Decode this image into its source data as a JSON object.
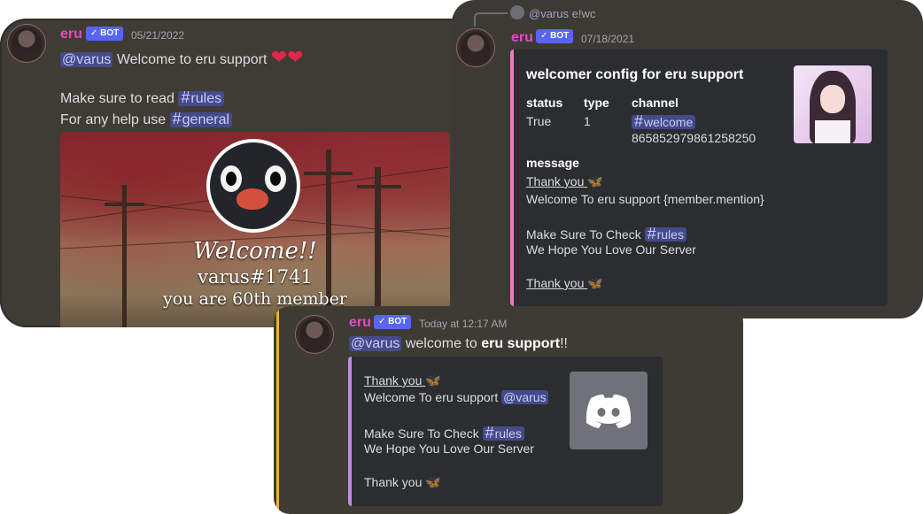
{
  "card_a": {
    "author": "eru",
    "bot_badge": "✓ BOT",
    "timestamp": "05/21/2022",
    "line1": {
      "mention": "@varus",
      "text": "Welcome to eru support",
      "hearts": "❤❤"
    },
    "line2": {
      "text": "Make sure to read",
      "channel": "rules"
    },
    "line3": {
      "text": "For any help use",
      "channel": "general"
    },
    "banner": {
      "welcome": "Welcome!!",
      "username": "varus#1741",
      "member_count_text": "you are 60th member"
    }
  },
  "card_b": {
    "reply": {
      "mention": "@varus",
      "command": "e!wc"
    },
    "author": "eru",
    "bot_badge": "✓ BOT",
    "timestamp": "07/18/2021",
    "embed": {
      "title": "welcomer config for eru support",
      "fields": {
        "status_label": "status",
        "status_value": "True",
        "type_label": "type",
        "type_value": "1",
        "channel_label": "channel",
        "channel_name": "welcome",
        "channel_id": "865852979861258250"
      },
      "message_label": "message",
      "message_lines": {
        "l1": "Thank you ",
        "l2": "Welcome To eru support {member.mention}",
        "l3": "Make Sure To Check",
        "l3_channel": "rules",
        "l4": "We Hope You Love Our Server",
        "l5": "Thank you "
      },
      "butterfly": "🦋"
    }
  },
  "card_c": {
    "author": "eru",
    "bot_badge": "✓ BOT",
    "timestamp": "Today at 12:17 AM",
    "content": {
      "mention": "@varus",
      "text_before": "welcome to",
      "bold": "eru support",
      "text_after": "!!"
    },
    "embed": {
      "l1": "Thank you ",
      "l2": "Welcome To eru support",
      "l2_mention": "@varus",
      "l3": "Make Sure To Check",
      "l3_channel": "rules",
      "l4": "We Hope You Love Our Server",
      "l5": "Thank you ",
      "butterfly": "🦋"
    }
  },
  "colors": {
    "accent_name": "#e44bc4",
    "bot_badge": "#5865f2",
    "embed_border_b": "#f07ab8",
    "embed_border_c": "#c58be0",
    "highlight_bar": "#f0b232"
  }
}
